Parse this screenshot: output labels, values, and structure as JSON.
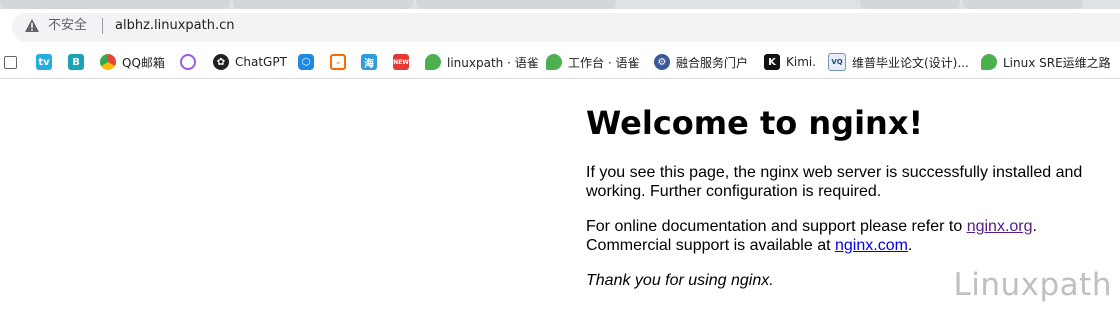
{
  "addressbar": {
    "security_label": "不安全",
    "url": "albhz.linuxpath.cn"
  },
  "bookmarks": [
    {
      "label": "",
      "icon": "frame-icon"
    },
    {
      "label": "",
      "icon": "bilibili-icon"
    },
    {
      "label": "",
      "icon": "b-app-icon"
    },
    {
      "label": "QQ邮箱",
      "icon": "qqmail-icon"
    },
    {
      "label": "",
      "icon": "tongyi-icon"
    },
    {
      "label": "ChatGPT",
      "icon": "openai-icon"
    },
    {
      "label": "",
      "icon": "hexagon-app-icon"
    },
    {
      "label": "",
      "icon": "aliyun-icon"
    },
    {
      "label": "",
      "icon": "hai-icon"
    },
    {
      "label": "",
      "icon": "red-app-icon"
    },
    {
      "label": "linuxpath · 语雀",
      "icon": "yuque-icon"
    },
    {
      "label": "工作台 · 语雀",
      "icon": "yuque-icon"
    },
    {
      "label": "融合服务门户",
      "icon": "portal-icon"
    },
    {
      "label": "Kimi.",
      "icon": "kimi-icon"
    },
    {
      "label": "维普毕业论文(设计)...",
      "icon": "vip-icon"
    },
    {
      "label": "Linux SRE运维之路",
      "icon": "yuque-icon"
    }
  ],
  "page": {
    "title": "Welcome to nginx!",
    "p1": "If you see this page, the nginx web server is successfully installed and working. Further configuration is required.",
    "p2_pre": "For online documentation and support please refer to ",
    "p2_link1": "nginx.org",
    "p2_mid": ".",
    "p2_line2_pre": "Commercial support is available at ",
    "p2_link2": "nginx.com",
    "p2_end": ".",
    "p3": "Thank you for using nginx."
  },
  "watermark": "Linuxpath",
  "colors": {
    "link": "#0000ee",
    "link_visited": "#551a8b",
    "yuque_green": "#4caf50"
  }
}
